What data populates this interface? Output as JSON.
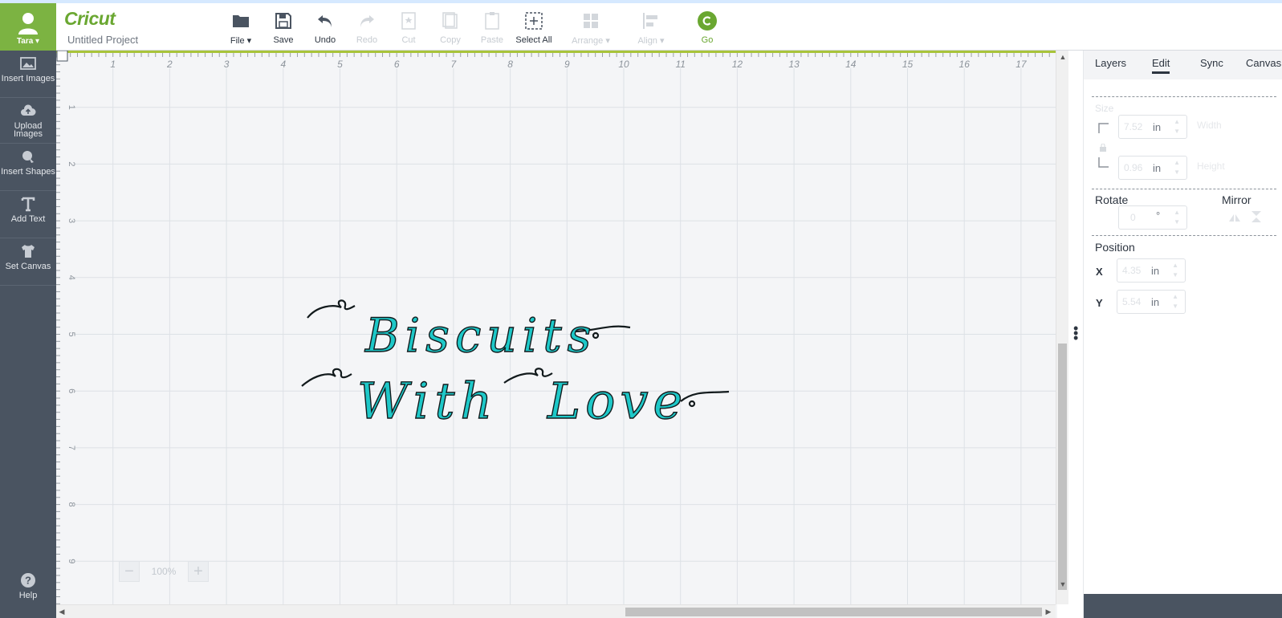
{
  "header": {
    "user_name": "Tara",
    "logo_text": "Cricut",
    "project_title": "Untitled Project"
  },
  "toolbar": {
    "file": "File",
    "save": "Save",
    "undo": "Undo",
    "redo": "Redo",
    "cut": "Cut",
    "copy": "Copy",
    "paste": "Paste",
    "select_all": "Select All",
    "arrange": "Arrange",
    "align": "Align",
    "go": "Go"
  },
  "sidebar": {
    "insert_images": "Insert Images",
    "upload_images": "Upload Images",
    "insert_shapes": "Insert Shapes",
    "add_text": "Add Text",
    "set_canvas": "Set Canvas",
    "help": "Help"
  },
  "canvas": {
    "line1": "Biscuits",
    "line2_word1": "With",
    "line2_word2": "Love",
    "zoom": "100%",
    "ruler_top": [
      "1",
      "2",
      "3",
      "4",
      "5",
      "6",
      "7",
      "8",
      "9",
      "10",
      "11",
      "12",
      "13",
      "14",
      "15",
      "16",
      "17"
    ],
    "ruler_left": [
      "1",
      "2",
      "3",
      "4",
      "5",
      "6",
      "7",
      "8",
      "9"
    ],
    "design_color": "#1ec8c8"
  },
  "panel": {
    "tabs": [
      "Layers",
      "Edit",
      "Sync",
      "Canvas"
    ],
    "size": {
      "title": "Size",
      "width": "7.52",
      "height": "0.96",
      "unit": "in",
      "width_label": "Width",
      "height_label": "Height"
    },
    "rotate": {
      "title": "Rotate",
      "value": "0",
      "unit": "°"
    },
    "mirror": {
      "title": "Mirror"
    },
    "position": {
      "title": "Position",
      "x_label": "X",
      "y_label": "Y",
      "x": "4.35",
      "y": "5.54",
      "unit": "in"
    }
  },
  "colors": {
    "accent_green": "#7cb342",
    "sidebar_bg": "#4a5461",
    "canvas_bg": "#f4f5f7"
  }
}
